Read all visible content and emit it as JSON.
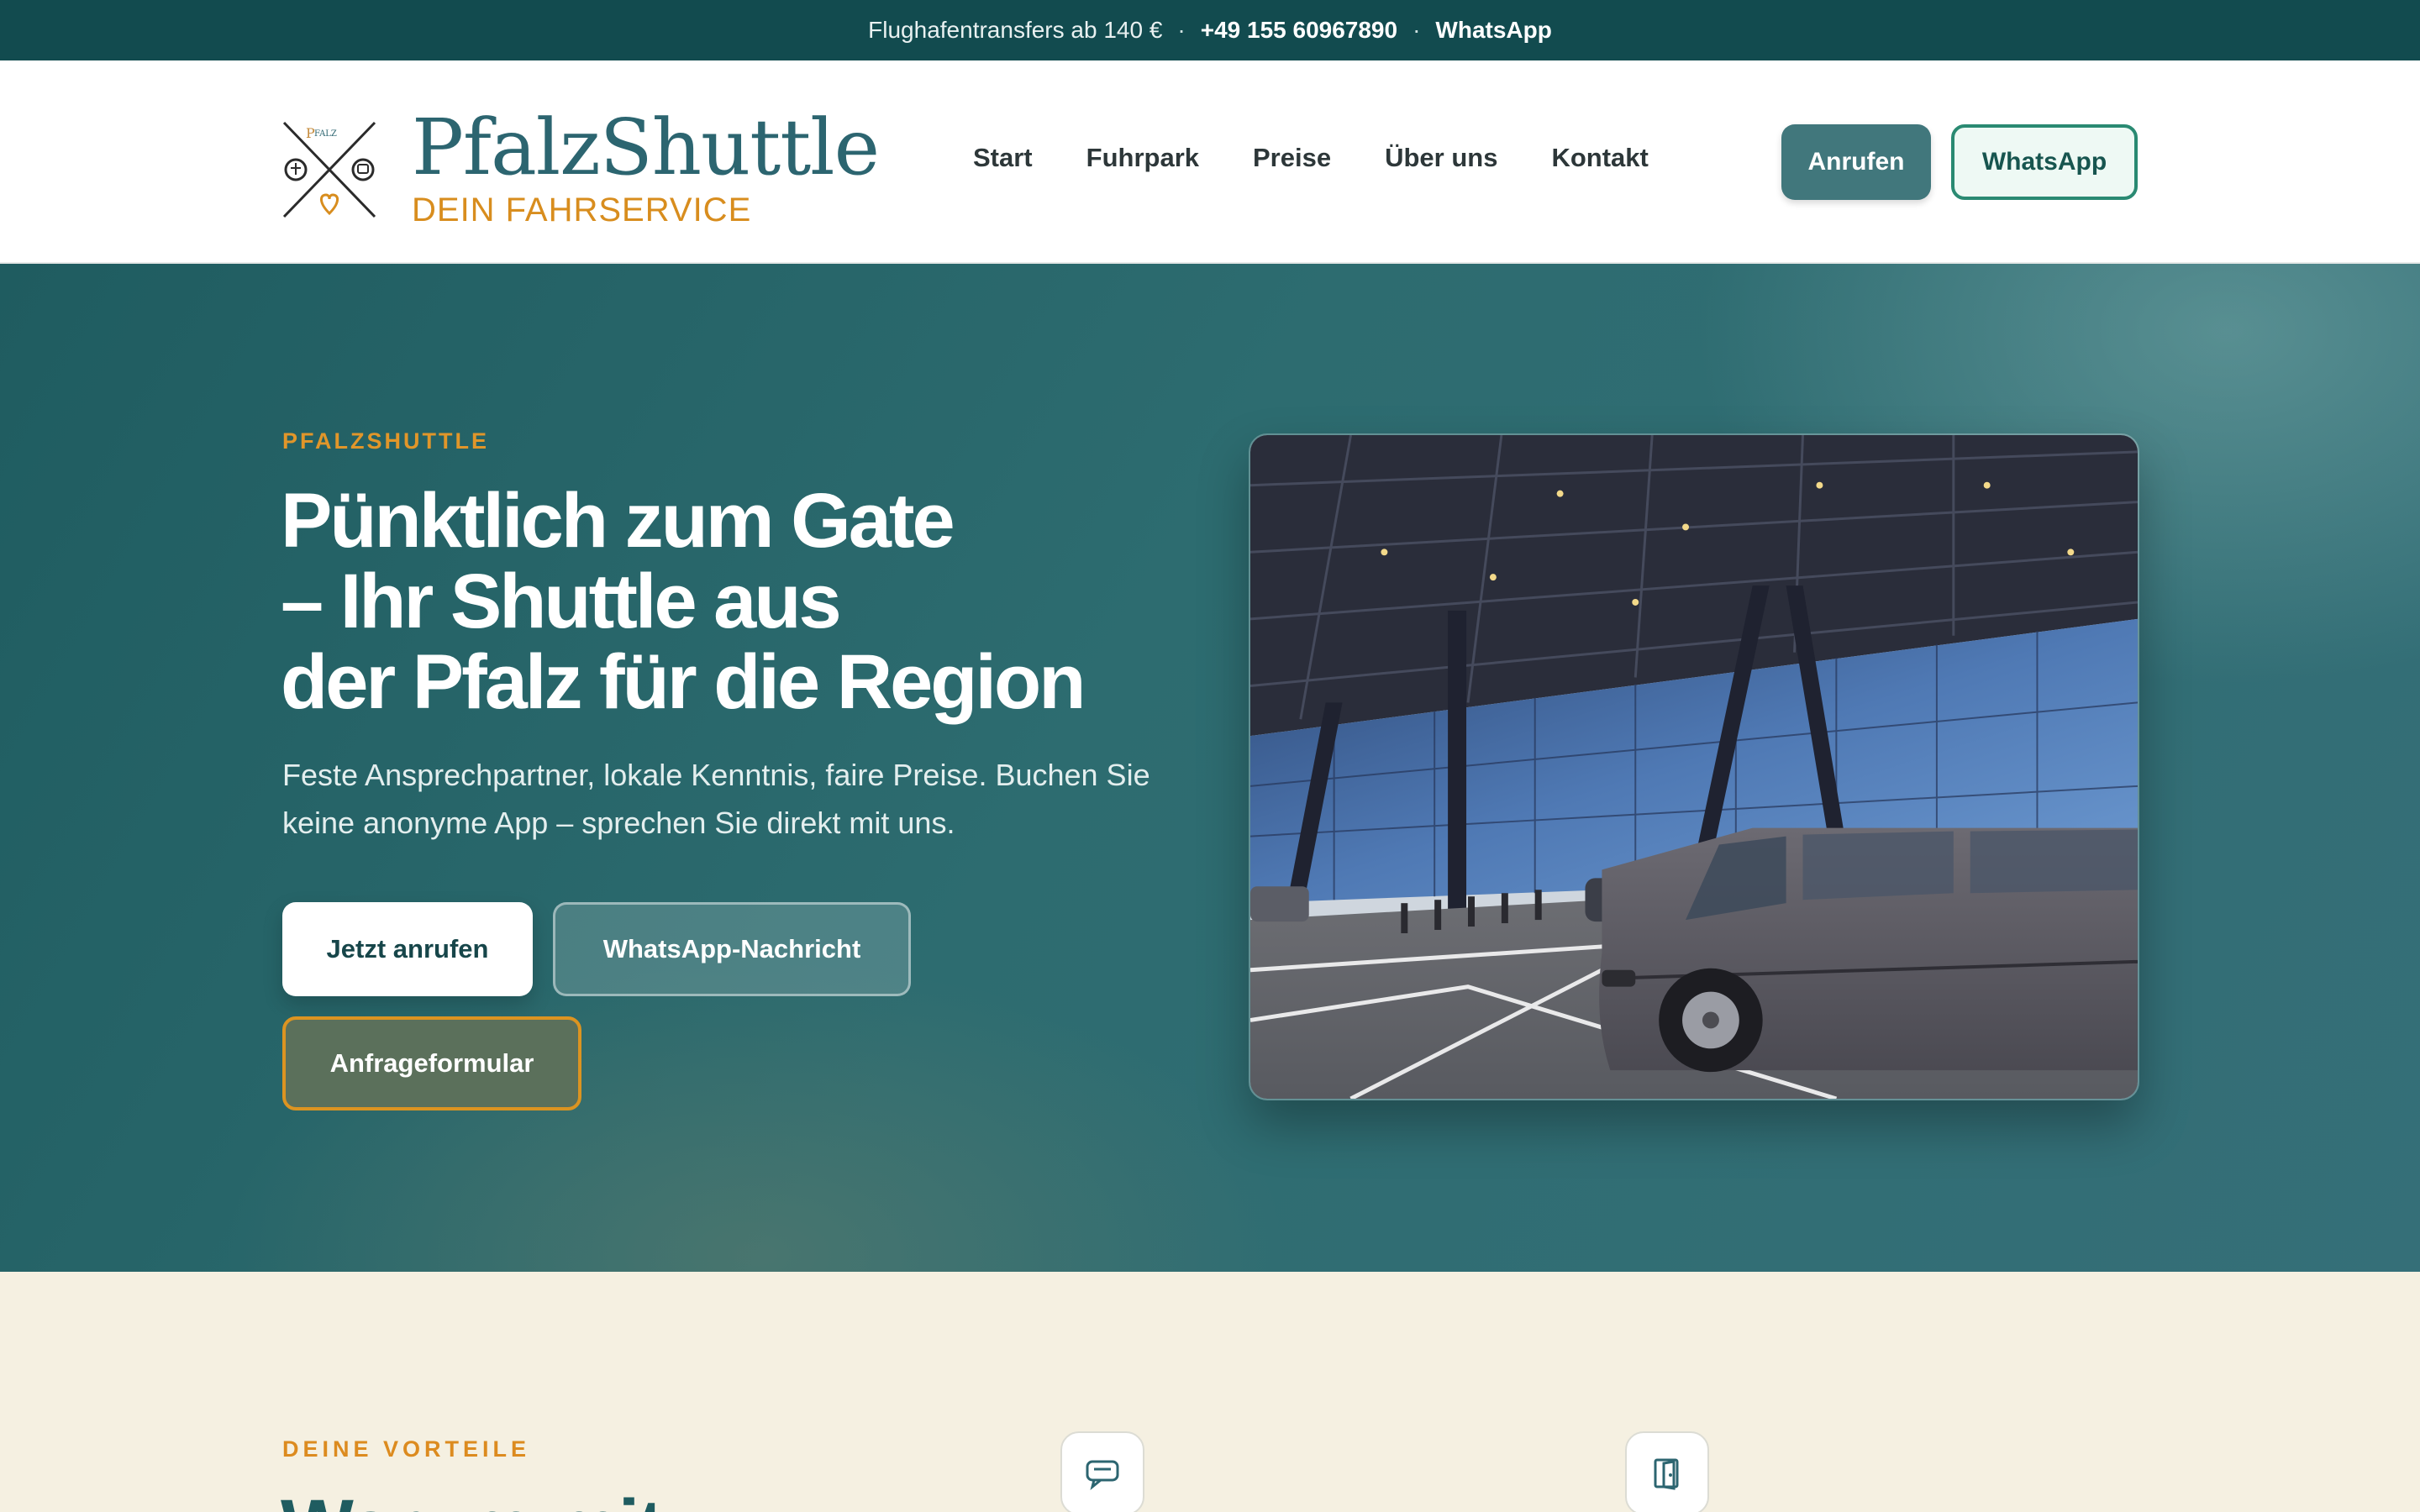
{
  "topbar": {
    "offer": "Flughafentransfers ab 140 €",
    "sep1": "·",
    "phone": "+49 155 60967890",
    "sep2": "·",
    "whatsapp": "WhatsApp"
  },
  "header": {
    "logo_title": "PfalzShuttle",
    "logo_subtitle": "DEIN FAHRSERVICE",
    "nav": [
      "Start",
      "Fuhrpark",
      "Preise",
      "Über uns",
      "Kontakt"
    ],
    "call_button": "Anrufen",
    "whatsapp_button": "WhatsApp"
  },
  "hero": {
    "eyebrow": "PFALZSHUTTLE",
    "headline_line1": "Pünktlich zum Gate",
    "headline_line2": "– Ihr Shuttle aus",
    "headline_line3": "der Pfalz für die Region",
    "lead": "Feste Ansprechpartner, lokale Kenntnis, faire Preise. Buchen Sie keine anonyme App – sprechen Sie direkt mit uns.",
    "cta_call": "Jetzt anrufen",
    "cta_whatsapp": "WhatsApp-Nachricht",
    "cta_form": "Anfrageformular"
  },
  "section": {
    "eyebrow": "DEINE VORTEILE",
    "title": "Warum mit",
    "icons": [
      "chat-icon",
      "door-icon"
    ]
  },
  "colors": {
    "topbar": "#124b4f",
    "brand_teal": "#2c6570",
    "accent_orange": "#d88d1e",
    "cream": "#f5f0e1"
  }
}
